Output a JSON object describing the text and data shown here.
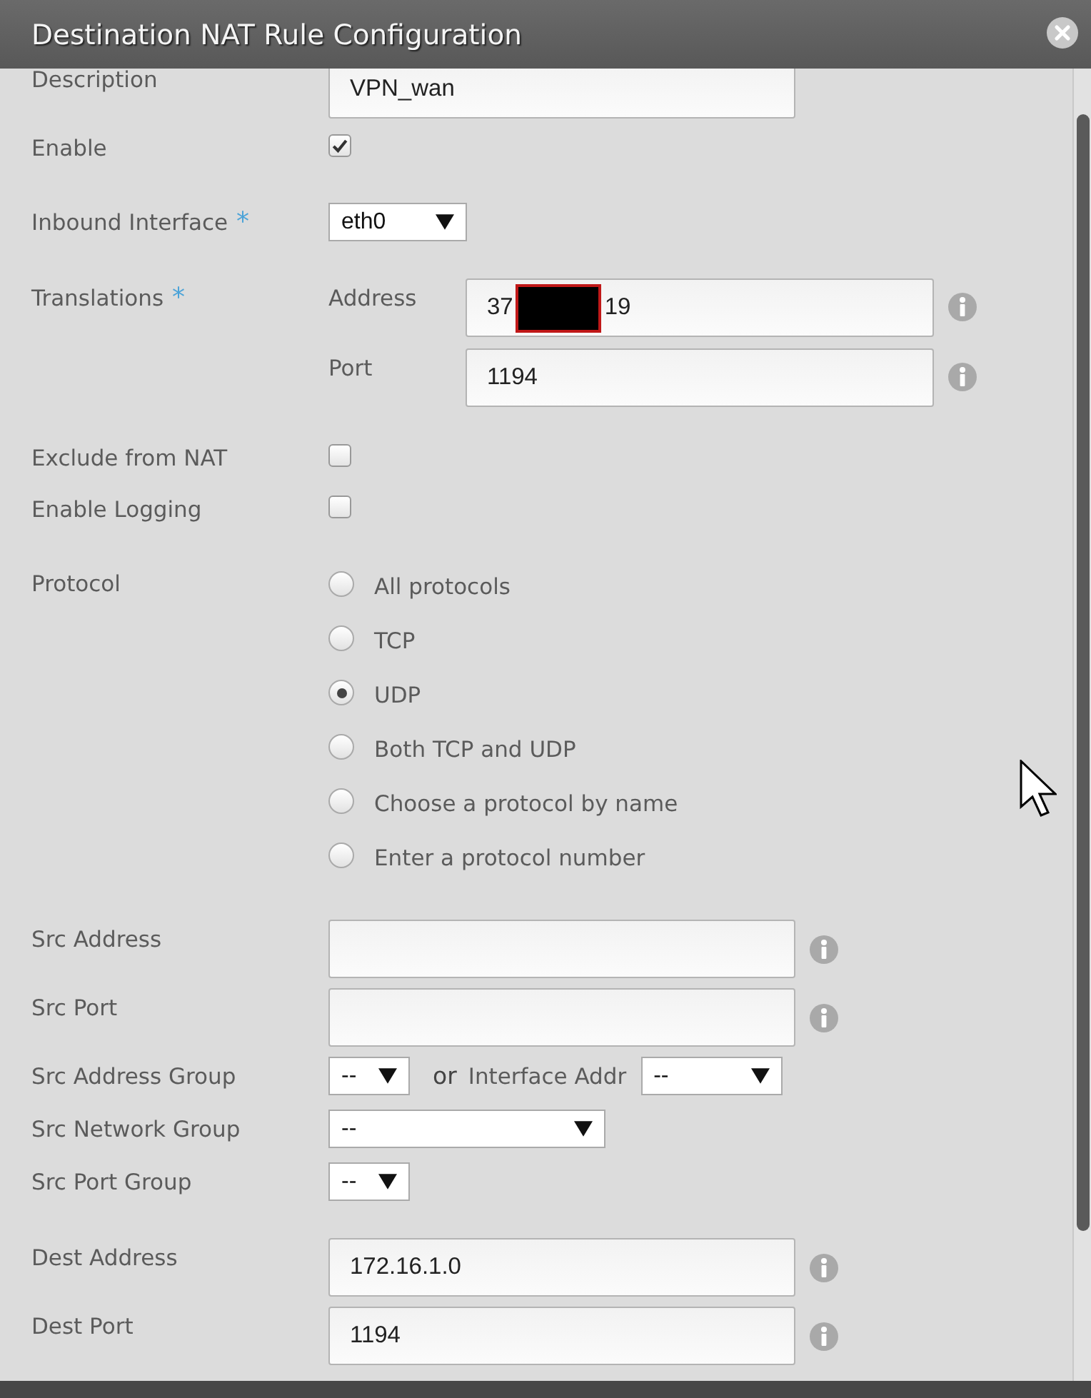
{
  "window": {
    "title": "Destination NAT Rule Configuration"
  },
  "sections": [
    {
      "fields": [
        {
          "kind": "text",
          "label": "Description",
          "value": "VPN_wan",
          "info": false
        },
        {
          "kind": "checkbox",
          "label": "Enable",
          "checked": true
        }
      ]
    },
    {
      "fields": [
        {
          "kind": "select",
          "label": "Inbound Interface",
          "required_mark": "*",
          "value": "eth0"
        }
      ]
    },
    {
      "fields": [
        {
          "kind": "translations",
          "label": "Translations",
          "required_mark": "*",
          "address": {
            "label": "Address",
            "value_parts": [
              "37",
              "19"
            ],
            "redacted": true,
            "info": true
          },
          "port": {
            "label": "Port",
            "value": "1194",
            "info": true
          }
        }
      ]
    },
    {
      "fields": [
        {
          "kind": "checkbox",
          "label": "Exclude from NAT",
          "checked": false
        },
        {
          "kind": "checkbox",
          "label": "Enable Logging",
          "checked": false
        }
      ]
    },
    {
      "fields": [
        {
          "kind": "radio",
          "label": "Protocol",
          "options": [
            {
              "label": "All protocols",
              "selected": false
            },
            {
              "label": "TCP",
              "selected": false
            },
            {
              "label": "UDP",
              "selected": true
            },
            {
              "label": "Both TCP and UDP",
              "selected": false
            },
            {
              "label": "Choose a protocol by name",
              "selected": false
            },
            {
              "label": "Enter a protocol number",
              "selected": false
            }
          ]
        }
      ]
    },
    {
      "fields": [
        {
          "kind": "text",
          "label": "Src Address",
          "info": true
        },
        {
          "kind": "text",
          "label": "Src Port",
          "info": true
        },
        {
          "kind": "select-pair",
          "label": "Src Address Group",
          "value": "--",
          "connector": "or",
          "second_label": "Interface Addr",
          "second_value": "--"
        },
        {
          "kind": "wide-select",
          "label": "Src Network Group",
          "value": "--"
        },
        {
          "kind": "narrow-select",
          "label": "Src Port Group",
          "value": "--"
        }
      ]
    },
    {
      "fields": [
        {
          "kind": "text",
          "label": "Dest Address",
          "value": "172.16.1.0",
          "info": true
        },
        {
          "kind": "text",
          "label": "Dest Port",
          "value": "1194",
          "info": true
        }
      ]
    }
  ]
}
